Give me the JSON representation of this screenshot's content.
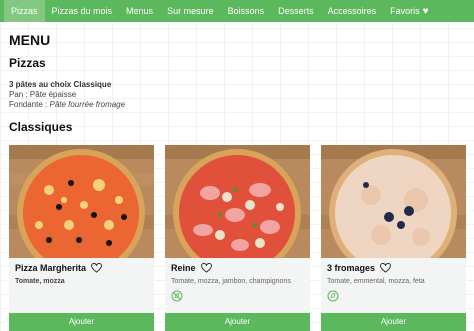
{
  "nav": {
    "items": [
      {
        "label": "Pizzas",
        "active": true
      },
      {
        "label": "Pizzas du mois"
      },
      {
        "label": "Menus"
      },
      {
        "label": "Sur mesure"
      },
      {
        "label": "Boissons"
      },
      {
        "label": "Desserts"
      },
      {
        "label": "Accessoires"
      },
      {
        "label": "Favoris",
        "icon": "heart-icon"
      }
    ]
  },
  "page": {
    "title": "MENU",
    "section_title": "Pizzas",
    "info": {
      "title": "3 pâtes au choix Classique",
      "line1_label": "Pan : ",
      "line1_value": "Pâte épaisse",
      "line2_label": "Fondante : ",
      "line2_value": "Pâte fourrée fromage"
    },
    "subsection_title": "Classiques"
  },
  "products": [
    {
      "name": "Pizza Margherita",
      "description": "Tomate, mozza",
      "icon": "heart-outline-icon",
      "badge_icon": null
    },
    {
      "name": "Reine",
      "description": "Tomate, mozza, jambon, champignons",
      "icon": "heart-outline-icon",
      "badge_icon": "no-vegetarian-icon"
    },
    {
      "name": "3 fromages",
      "description": "Tomate, emmental, mozza, feta",
      "icon": "heart-outline-icon",
      "badge_icon": "vegetarian-icon"
    }
  ],
  "add_label": "Ajouter",
  "colors": {
    "brand_green": "#5cb85c",
    "active_tab": "#82c882"
  }
}
